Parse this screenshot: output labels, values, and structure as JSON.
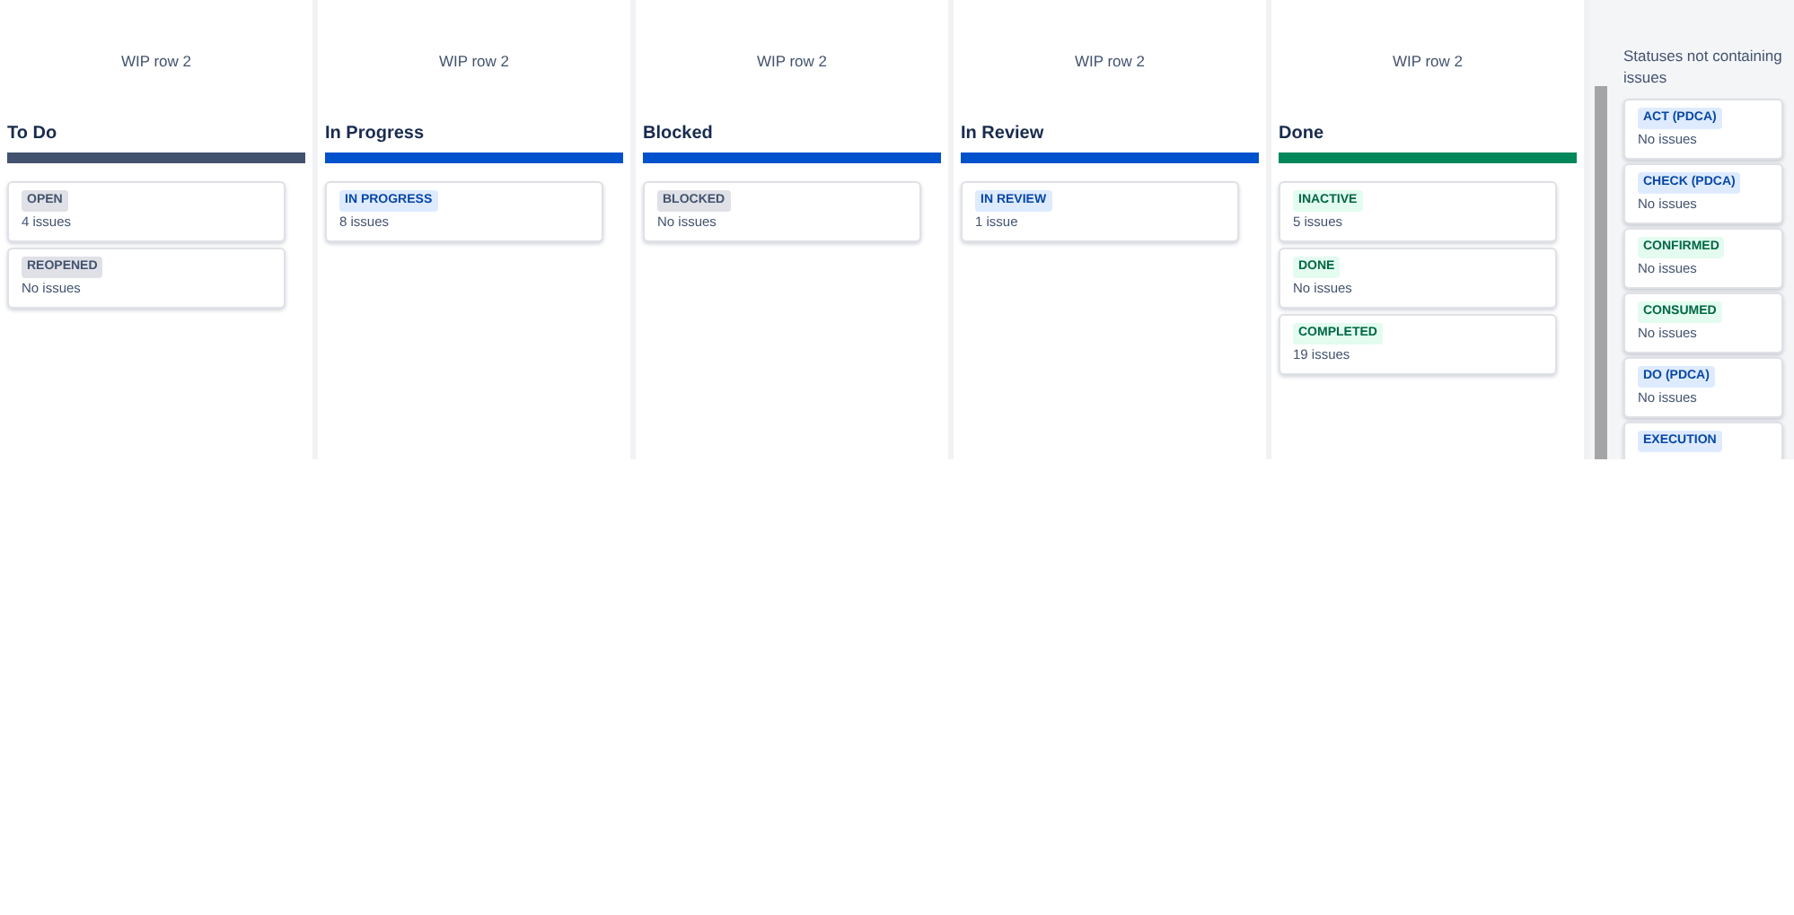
{
  "columns": [
    {
      "wip": "WIP row 2",
      "title": "To Do",
      "color": "#42526e",
      "statuses": [
        {
          "name": "OPEN",
          "color": "#dfe1e6",
          "count": "4 issues"
        },
        {
          "name": "REOPENED",
          "color": "#dfe1e6",
          "count": "No issues"
        }
      ]
    },
    {
      "wip": "WIP row 2",
      "title": "In Progress",
      "color": "#0052cc",
      "statuses": [
        {
          "name": "IN PROGRESS",
          "color": "#deebff",
          "count": "8 issues"
        }
      ]
    },
    {
      "wip": "WIP row 2",
      "title": "Blocked",
      "color": "#0052cc",
      "statuses": [
        {
          "name": "BLOCKED",
          "color": "#dfe1e6",
          "count": "No issues"
        }
      ]
    },
    {
      "wip": "WIP row 2",
      "title": "In Review",
      "color": "#0052cc",
      "statuses": [
        {
          "name": "IN REVIEW",
          "color": "#deebff",
          "count": "1 issue"
        }
      ]
    },
    {
      "wip": "WIP row 2",
      "title": "Done",
      "color": "#00875a",
      "statuses": [
        {
          "name": "INACTIVE",
          "color": "#e3fcef",
          "count": "5 issues"
        },
        {
          "name": "DONE",
          "color": "#e3fcef",
          "count": "No issues"
        },
        {
          "name": "COMPLETED",
          "color": "#e3fcef",
          "count": "19 issues"
        }
      ]
    }
  ],
  "unused_panel": {
    "title": "Statuses not containing issues",
    "statuses": [
      {
        "name": "ACT (PDCA)",
        "color": "#deebff",
        "count": "No issues"
      },
      {
        "name": "CHECK (PDCA)",
        "color": "#deebff",
        "count": "No issues"
      },
      {
        "name": "CONFIRMED",
        "color": "#e3fcef",
        "count": "No issues"
      },
      {
        "name": "CONSUMED",
        "color": "#e3fcef",
        "count": "No issues"
      },
      {
        "name": "DO (PDCA)",
        "color": "#deebff",
        "count": "No issues"
      },
      {
        "name": "EXECUTION",
        "color": "#deebff"
      }
    ]
  }
}
